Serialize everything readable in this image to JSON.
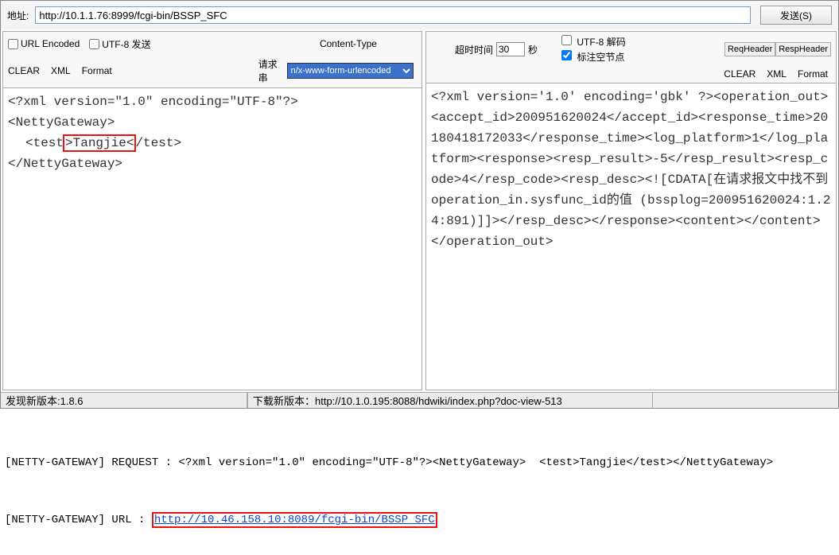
{
  "address": {
    "label": "地址:",
    "value": "http://10.1.1.76:8999/fcgi-bin/BSSP_SFC",
    "send": "发送(S)"
  },
  "leftPanel": {
    "urlEncoded": "URL Encoded",
    "utf8Send": "UTF-8 发送",
    "contentTypeLabel": "Content-Type",
    "clear": "CLEAR",
    "xml": "XML",
    "format": "Format",
    "reqStr": "请求串",
    "contentTypeValue": "n/x-www-form-urlencoded",
    "body": {
      "l1": "<?xml version=\"1.0\" encoding=\"UTF-8\"?>",
      "l2": "<NettyGateway>",
      "l3a": "<test",
      "hl1": ">Tangjie<",
      "l3b": "/test>",
      "l4": "</NettyGateway>"
    }
  },
  "rightPanel": {
    "timeoutLabel": "超时时间",
    "timeoutValue": "30",
    "seconds": "秒",
    "utf8Decode": "UTF-8 解码",
    "markEmpty": "标注空节点",
    "reqHeader": "ReqHeader",
    "respHeader": "RespHeader",
    "clear": "CLEAR",
    "xml": "XML",
    "format": "Format",
    "body": "<?xml version='1.0' encoding='gbk' ?><operation_out><accept_id>200951620024</accept_id><response_time>20180418172033</response_time><log_platform>1</log_platform><response><resp_result>-5</resp_result><resp_code>4</resp_code><resp_desc><![CDATA[在请求报文中找不到operation_in.sysfunc_id的值 (bssplog=200951620024:1.24:891)]]></resp_desc></response><content></content></operation_out>"
  },
  "status": {
    "version": "发现新版本:1.8.6",
    "download": "下载新版本：http://10.1.0.195:8088/hdwiki/index.php?doc-view-513"
  },
  "log": {
    "reqPrefix": "[NETTY-GATEWAY] REQUEST : ",
    "reqBody": "<?xml version=\"1.0\" encoding=\"UTF-8\"?><NettyGateway>  <test>Tangjie</test></NettyGateway>",
    "urlPrefix": "[NETTY-GATEWAY] URL : ",
    "url": "http://10.46.158.10:8089/fcgi-bin/BSSP_SFC"
  }
}
